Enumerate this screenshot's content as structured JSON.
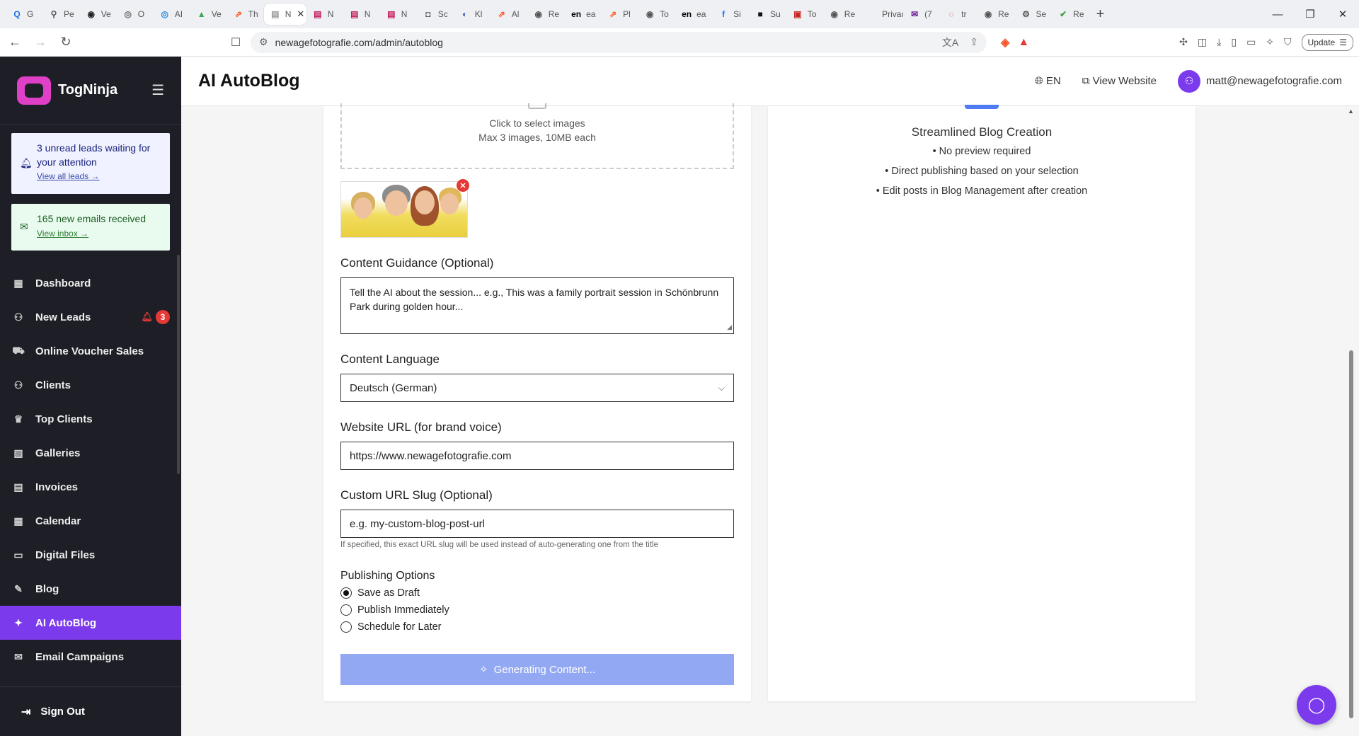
{
  "browser": {
    "tabs": [
      {
        "label": "G",
        "color": "#1a73e8",
        "glyph": "Q"
      },
      {
        "label": "Pe",
        "color": "#555",
        "glyph": "⚲"
      },
      {
        "label": "Ve",
        "color": "#222",
        "glyph": "◉"
      },
      {
        "label": "O",
        "color": "#666",
        "glyph": "◎"
      },
      {
        "label": "AI",
        "color": "#1e88e5",
        "glyph": "◎"
      },
      {
        "label": "Ve",
        "color": "#34a853",
        "glyph": "▲"
      },
      {
        "label": "Th",
        "color": "#ff5722",
        "glyph": "⇗"
      },
      {
        "label": "N",
        "color": "#999",
        "glyph": "▤"
      },
      {
        "label": "N",
        "color": "#c2185b",
        "glyph": "▤"
      },
      {
        "label": "N",
        "color": "#c2185b",
        "glyph": "▤"
      },
      {
        "label": "N",
        "color": "#c2185b",
        "glyph": "▤"
      },
      {
        "label": "Sc",
        "color": "#555",
        "glyph": "◘"
      },
      {
        "label": "Kl",
        "color": "#3f51b5",
        "glyph": "◐"
      },
      {
        "label": "Al",
        "color": "#ff5722",
        "glyph": "⇗"
      },
      {
        "label": "Re",
        "color": "#555",
        "glyph": "◉"
      },
      {
        "label": "ea",
        "color": "#000",
        "glyph": "en"
      },
      {
        "label": "Pl",
        "color": "#ff5722",
        "glyph": "⇗"
      },
      {
        "label": "To",
        "color": "#555",
        "glyph": "◉"
      },
      {
        "label": "ea",
        "color": "#000",
        "glyph": "en"
      },
      {
        "label": "Si",
        "color": "#1877f2",
        "glyph": "f"
      },
      {
        "label": "Su",
        "color": "#111",
        "glyph": "■"
      },
      {
        "label": "To",
        "color": "#c62828",
        "glyph": "▣"
      },
      {
        "label": "Re",
        "color": "#555",
        "glyph": "◉"
      },
      {
        "label": "Privac",
        "color": "#888",
        "glyph": ""
      },
      {
        "label": "(7",
        "color": "#6a1b9a",
        "glyph": "✉"
      },
      {
        "label": "tr",
        "color": "#e53935",
        "glyph": "◌"
      },
      {
        "label": "Re",
        "color": "#555",
        "glyph": "◉"
      },
      {
        "label": "Se",
        "color": "#555",
        "glyph": "⚙"
      },
      {
        "label": "Re",
        "color": "#43a047",
        "glyph": "✔"
      }
    ],
    "active_tab_index": 7,
    "url": "newagefotografie.com/admin/autoblog",
    "update_label": "Update"
  },
  "sidebar": {
    "brand": "TogNinja",
    "leads_notice": {
      "text": "3 unread leads waiting for your attention",
      "link": "View all leads →"
    },
    "mail_notice": {
      "text": "165 new emails received",
      "link": "View inbox →"
    },
    "items": [
      {
        "label": "Dashboard",
        "icon": "▦",
        "name": "dashboard"
      },
      {
        "label": "New Leads",
        "icon": "⚇",
        "name": "new-leads",
        "badge": "3"
      },
      {
        "label": "Online Voucher Sales",
        "icon": "⛟",
        "name": "voucher-sales"
      },
      {
        "label": "Clients",
        "icon": "⚇",
        "name": "clients"
      },
      {
        "label": "Top Clients",
        "icon": "♛",
        "name": "top-clients"
      },
      {
        "label": "Galleries",
        "icon": "▧",
        "name": "galleries"
      },
      {
        "label": "Invoices",
        "icon": "▤",
        "name": "invoices"
      },
      {
        "label": "Calendar",
        "icon": "▦",
        "name": "calendar"
      },
      {
        "label": "Digital Files",
        "icon": "▭",
        "name": "digital-files"
      },
      {
        "label": "Blog",
        "icon": "✎",
        "name": "blog"
      },
      {
        "label": "AI AutoBlog",
        "icon": "✦",
        "name": "ai-autoblog",
        "active": true
      },
      {
        "label": "Email Campaigns",
        "icon": "✉",
        "name": "email-campaigns"
      }
    ],
    "sign_out": "Sign Out"
  },
  "header": {
    "title": "AI AutoBlog",
    "language": "EN",
    "view_website": "View Website",
    "user_email": "matt@newagefotografie.com"
  },
  "form": {
    "upload_primary": "Click to select images",
    "upload_secondary": "Max 3 images, 10MB each",
    "guidance_label": "Content Guidance (Optional)",
    "guidance_placeholder": "Tell the AI about the session... e.g., This was a family portrait session in Schönbrunn Park during golden hour...",
    "language_label": "Content Language",
    "language_value": "Deutsch (German)",
    "website_label": "Website URL (for brand voice)",
    "website_value": "https://www.newagefotografie.com",
    "slug_label": "Custom URL Slug (Optional)",
    "slug_placeholder": "e.g. my-custom-blog-post-url",
    "slug_help": "If specified, this exact URL slug will be used instead of auto-generating one from the title",
    "publishing_label": "Publishing Options",
    "options": [
      {
        "label": "Save as Draft",
        "selected": true
      },
      {
        "label": "Publish Immediately",
        "selected": false
      },
      {
        "label": "Schedule for Later",
        "selected": false
      }
    ],
    "generate_button": "Generating Content..."
  },
  "info_panel": {
    "title": "Streamlined Blog Creation",
    "bullets": [
      "• No preview required",
      "• Direct publishing based on your selection",
      "• Edit posts in Blog Management after creation"
    ]
  },
  "colors": {
    "accent": "#7c3aed",
    "sidebar_bg": "#1e1f26",
    "button_disabled": "#93a8f2",
    "badge": "#e53935"
  }
}
